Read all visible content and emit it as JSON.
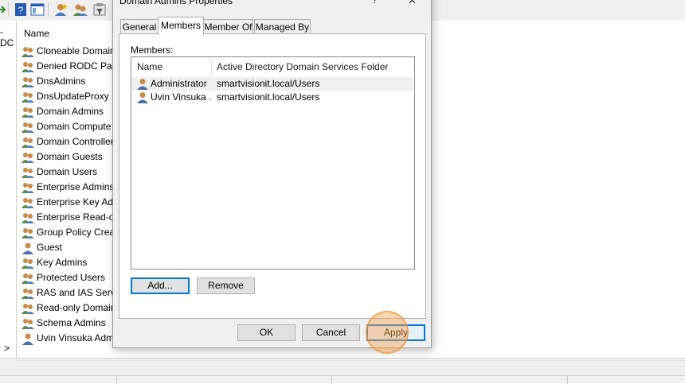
{
  "toolbar": {
    "icons": [
      "arrow-icon",
      "help-icon",
      "console-icon",
      "new-user-icon",
      "new-group-icon",
      "filter-icon"
    ]
  },
  "left_pane": {
    "truncated_text": "-DC",
    "expand_glyph": ">"
  },
  "list": {
    "column_name": "Name",
    "items": [
      {
        "label": "Cloneable Domain",
        "icon": "group-icon"
      },
      {
        "label": "Denied RODC Pass",
        "icon": "group-icon"
      },
      {
        "label": "DnsAdmins",
        "icon": "group-icon"
      },
      {
        "label": "DnsUpdateProxy",
        "icon": "group-icon"
      },
      {
        "label": "Domain Admins",
        "icon": "group-icon"
      },
      {
        "label": "Domain Compute",
        "icon": "group-icon"
      },
      {
        "label": "Domain Controller",
        "icon": "group-icon"
      },
      {
        "label": "Domain Guests",
        "icon": "group-icon"
      },
      {
        "label": "Domain Users",
        "icon": "group-icon"
      },
      {
        "label": "Enterprise Admins",
        "icon": "group-icon"
      },
      {
        "label": "Enterprise Key Adm",
        "icon": "group-icon"
      },
      {
        "label": "Enterprise Read-or",
        "icon": "group-icon"
      },
      {
        "label": "Group Policy Crea",
        "icon": "group-icon"
      },
      {
        "label": "Guest",
        "icon": "user-icon"
      },
      {
        "label": "Key Admins",
        "icon": "group-icon"
      },
      {
        "label": "Protected Users",
        "icon": "group-icon"
      },
      {
        "label": "RAS and IAS Serve",
        "icon": "group-icon"
      },
      {
        "label": "Read-only Domain",
        "icon": "group-icon"
      },
      {
        "label": "Schema Admins",
        "icon": "group-icon"
      },
      {
        "label": "Uvin Vinsuka Adm",
        "icon": "user-icon"
      }
    ]
  },
  "dialog": {
    "title": "Domain Admins Properties",
    "help_glyph": "?",
    "close_glyph": "✕",
    "tabs": [
      {
        "label": "General",
        "active": false
      },
      {
        "label": "Members",
        "active": true
      },
      {
        "label": "Member Of",
        "active": false
      },
      {
        "label": "Managed By",
        "active": false
      }
    ],
    "members_label": "Members:",
    "columns": {
      "name": "Name",
      "folder": "Active Directory Domain Services Folder"
    },
    "members": [
      {
        "name": "Administrator",
        "folder": "smartvisionit.local/Users",
        "selected": true
      },
      {
        "name": "Uvin Vinsuka ...",
        "folder": "smartvisionit.local/Users",
        "selected": false
      }
    ],
    "add_label": "Add...",
    "remove_label": "Remove",
    "ok_label": "OK",
    "cancel_label": "Cancel",
    "apply_label": "Apply"
  },
  "colors": {
    "accent": "#0078d7",
    "click_highlight": "#f8a550",
    "selection": "#f0f0f0"
  }
}
